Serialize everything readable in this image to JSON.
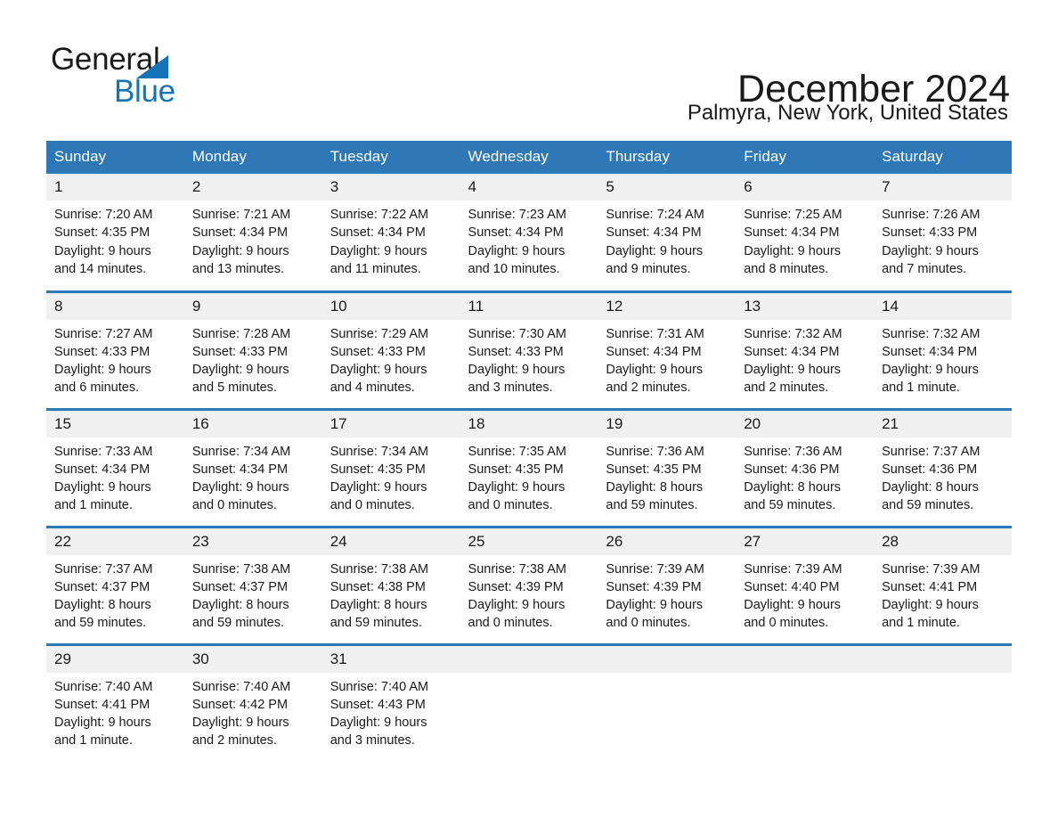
{
  "brand": {
    "name_top": "General",
    "name_bottom": "Blue",
    "accent_color": "#1574b8",
    "triangle_icon": "triangle-icon"
  },
  "header": {
    "title": "December 2024",
    "location": "Palmyra, New York, United States"
  },
  "theme": {
    "header_bg": "#2e78b8",
    "header_text": "#ffffff",
    "daynum_bg": "#f0f0f0",
    "row_rule": "#2e78b8",
    "body_text": "#1a1a1a"
  },
  "calendar": {
    "weekday_headers": [
      "Sunday",
      "Monday",
      "Tuesday",
      "Wednesday",
      "Thursday",
      "Friday",
      "Saturday"
    ],
    "weeks": [
      [
        {
          "date": "1",
          "lines": [
            "Sunrise: 7:20 AM",
            "Sunset: 4:35 PM",
            "Daylight: 9 hours",
            "and 14 minutes."
          ]
        },
        {
          "date": "2",
          "lines": [
            "Sunrise: 7:21 AM",
            "Sunset: 4:34 PM",
            "Daylight: 9 hours",
            "and 13 minutes."
          ]
        },
        {
          "date": "3",
          "lines": [
            "Sunrise: 7:22 AM",
            "Sunset: 4:34 PM",
            "Daylight: 9 hours",
            "and 11 minutes."
          ]
        },
        {
          "date": "4",
          "lines": [
            "Sunrise: 7:23 AM",
            "Sunset: 4:34 PM",
            "Daylight: 9 hours",
            "and 10 minutes."
          ]
        },
        {
          "date": "5",
          "lines": [
            "Sunrise: 7:24 AM",
            "Sunset: 4:34 PM",
            "Daylight: 9 hours",
            "and 9 minutes."
          ]
        },
        {
          "date": "6",
          "lines": [
            "Sunrise: 7:25 AM",
            "Sunset: 4:34 PM",
            "Daylight: 9 hours",
            "and 8 minutes."
          ]
        },
        {
          "date": "7",
          "lines": [
            "Sunrise: 7:26 AM",
            "Sunset: 4:33 PM",
            "Daylight: 9 hours",
            "and 7 minutes."
          ]
        }
      ],
      [
        {
          "date": "8",
          "lines": [
            "Sunrise: 7:27 AM",
            "Sunset: 4:33 PM",
            "Daylight: 9 hours",
            "and 6 minutes."
          ]
        },
        {
          "date": "9",
          "lines": [
            "Sunrise: 7:28 AM",
            "Sunset: 4:33 PM",
            "Daylight: 9 hours",
            "and 5 minutes."
          ]
        },
        {
          "date": "10",
          "lines": [
            "Sunrise: 7:29 AM",
            "Sunset: 4:33 PM",
            "Daylight: 9 hours",
            "and 4 minutes."
          ]
        },
        {
          "date": "11",
          "lines": [
            "Sunrise: 7:30 AM",
            "Sunset: 4:33 PM",
            "Daylight: 9 hours",
            "and 3 minutes."
          ]
        },
        {
          "date": "12",
          "lines": [
            "Sunrise: 7:31 AM",
            "Sunset: 4:34 PM",
            "Daylight: 9 hours",
            "and 2 minutes."
          ]
        },
        {
          "date": "13",
          "lines": [
            "Sunrise: 7:32 AM",
            "Sunset: 4:34 PM",
            "Daylight: 9 hours",
            "and 2 minutes."
          ]
        },
        {
          "date": "14",
          "lines": [
            "Sunrise: 7:32 AM",
            "Sunset: 4:34 PM",
            "Daylight: 9 hours",
            "and 1 minute."
          ]
        }
      ],
      [
        {
          "date": "15",
          "lines": [
            "Sunrise: 7:33 AM",
            "Sunset: 4:34 PM",
            "Daylight: 9 hours",
            "and 1 minute."
          ]
        },
        {
          "date": "16",
          "lines": [
            "Sunrise: 7:34 AM",
            "Sunset: 4:34 PM",
            "Daylight: 9 hours",
            "and 0 minutes."
          ]
        },
        {
          "date": "17",
          "lines": [
            "Sunrise: 7:34 AM",
            "Sunset: 4:35 PM",
            "Daylight: 9 hours",
            "and 0 minutes."
          ]
        },
        {
          "date": "18",
          "lines": [
            "Sunrise: 7:35 AM",
            "Sunset: 4:35 PM",
            "Daylight: 9 hours",
            "and 0 minutes."
          ]
        },
        {
          "date": "19",
          "lines": [
            "Sunrise: 7:36 AM",
            "Sunset: 4:35 PM",
            "Daylight: 8 hours",
            "and 59 minutes."
          ]
        },
        {
          "date": "20",
          "lines": [
            "Sunrise: 7:36 AM",
            "Sunset: 4:36 PM",
            "Daylight: 8 hours",
            "and 59 minutes."
          ]
        },
        {
          "date": "21",
          "lines": [
            "Sunrise: 7:37 AM",
            "Sunset: 4:36 PM",
            "Daylight: 8 hours",
            "and 59 minutes."
          ]
        }
      ],
      [
        {
          "date": "22",
          "lines": [
            "Sunrise: 7:37 AM",
            "Sunset: 4:37 PM",
            "Daylight: 8 hours",
            "and 59 minutes."
          ]
        },
        {
          "date": "23",
          "lines": [
            "Sunrise: 7:38 AM",
            "Sunset: 4:37 PM",
            "Daylight: 8 hours",
            "and 59 minutes."
          ]
        },
        {
          "date": "24",
          "lines": [
            "Sunrise: 7:38 AM",
            "Sunset: 4:38 PM",
            "Daylight: 8 hours",
            "and 59 minutes."
          ]
        },
        {
          "date": "25",
          "lines": [
            "Sunrise: 7:38 AM",
            "Sunset: 4:39 PM",
            "Daylight: 9 hours",
            "and 0 minutes."
          ]
        },
        {
          "date": "26",
          "lines": [
            "Sunrise: 7:39 AM",
            "Sunset: 4:39 PM",
            "Daylight: 9 hours",
            "and 0 minutes."
          ]
        },
        {
          "date": "27",
          "lines": [
            "Sunrise: 7:39 AM",
            "Sunset: 4:40 PM",
            "Daylight: 9 hours",
            "and 0 minutes."
          ]
        },
        {
          "date": "28",
          "lines": [
            "Sunrise: 7:39 AM",
            "Sunset: 4:41 PM",
            "Daylight: 9 hours",
            "and 1 minute."
          ]
        }
      ],
      [
        {
          "date": "29",
          "lines": [
            "Sunrise: 7:40 AM",
            "Sunset: 4:41 PM",
            "Daylight: 9 hours",
            "and 1 minute."
          ]
        },
        {
          "date": "30",
          "lines": [
            "Sunrise: 7:40 AM",
            "Sunset: 4:42 PM",
            "Daylight: 9 hours",
            "and 2 minutes."
          ]
        },
        {
          "date": "31",
          "lines": [
            "Sunrise: 7:40 AM",
            "Sunset: 4:43 PM",
            "Daylight: 9 hours",
            "and 3 minutes."
          ]
        },
        {
          "date": "",
          "lines": []
        },
        {
          "date": "",
          "lines": []
        },
        {
          "date": "",
          "lines": []
        },
        {
          "date": "",
          "lines": []
        }
      ]
    ]
  }
}
